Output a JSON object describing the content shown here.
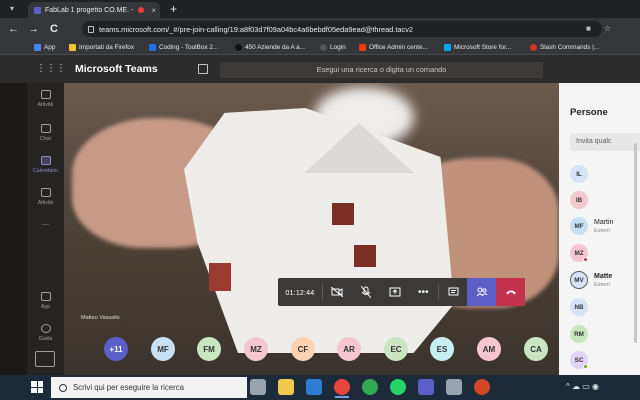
{
  "browser": {
    "tab_title": "FabLab 1 progetto CO.ME. - ",
    "tab_close": "×",
    "new_tab": "+",
    "url": "teams.microsoft.com/_#/pre-join-calling/19:a8f03d7f09a04bc4a6bebdf05eda9ead@thread.tacv2",
    "back": "←",
    "forward": "→",
    "reload": "C",
    "bookmarks": [
      {
        "label": "App",
        "color": "#4285f4"
      },
      {
        "label": "Importati da Firefox",
        "color": "#f4c430"
      },
      {
        "label": "Coding - ToolBox 2...",
        "color": "#1a73e8"
      },
      {
        "label": "450 Aziende da A a...",
        "color": "#111111"
      },
      {
        "label": "Login",
        "color": "#555555"
      },
      {
        "label": "Office Admin cente...",
        "color": "#eb3c00"
      },
      {
        "label": "Microsoft Store for...",
        "color": "#00a4ef"
      },
      {
        "label": "Slash Commands |...",
        "color": "#d93025"
      }
    ]
  },
  "teams": {
    "app_name": "Microsoft Teams",
    "search_placeholder": "Esegui una ricerca o digita un comando",
    "rail": [
      {
        "label": "Attività",
        "active": false
      },
      {
        "label": "Chat",
        "active": false
      },
      {
        "label": "Calendario",
        "active": true
      },
      {
        "label": "Attività",
        "active": false
      },
      {
        "label": "...",
        "active": false
      },
      {
        "label": "App",
        "active": false
      },
      {
        "label": "Guida",
        "active": false
      }
    ],
    "video_name": "Matteo Vassallo",
    "call": {
      "timer": "01:12:44"
    },
    "strip": [
      {
        "initials": "+11",
        "color": "#5b5fc7"
      },
      {
        "initials": "MF",
        "color": "#c7e0f4"
      },
      {
        "initials": "FM",
        "color": "#c9e6c0"
      },
      {
        "initials": "MZ",
        "color": "#f4c6d0"
      },
      {
        "initials": "CF",
        "color": "#fbd3b0"
      },
      {
        "initials": "AR",
        "color": "#f4c6d0"
      },
      {
        "initials": "EC",
        "color": "#c9e6c0"
      },
      {
        "initials": "ES",
        "color": "#c7eef0"
      },
      {
        "initials": "AM",
        "color": "#f4c6d0"
      },
      {
        "initials": "CA",
        "color": "#c9e6c0"
      }
    ],
    "people": {
      "title": "Persone",
      "invite_placeholder": "Invita qualc",
      "list": [
        {
          "initials": "IL",
          "color": "#d6e3f4",
          "name": "",
          "sub": "",
          "dot": ""
        },
        {
          "initials": "IB",
          "color": "#f4c6d0",
          "name": "",
          "sub": "",
          "dot": ""
        },
        {
          "initials": "MF",
          "color": "#c7e0f4",
          "name": "Martin",
          "sub": "Estern",
          "dot": ""
        },
        {
          "initials": "MZ",
          "color": "#f4c6d0",
          "name": "",
          "sub": "",
          "dot": "red"
        },
        {
          "initials": "MV",
          "color": "#d6e3f4",
          "name": "Matte",
          "sub": "Estern",
          "dot": ""
        },
        {
          "initials": "NB",
          "color": "#d6e3f4",
          "name": "",
          "sub": "",
          "dot": ""
        },
        {
          "initials": "RM",
          "color": "#c9e6c0",
          "name": "",
          "sub": "",
          "dot": ""
        },
        {
          "initials": "SC",
          "color": "#e0d3f4",
          "name": "",
          "sub": "",
          "dot": "green"
        }
      ]
    }
  },
  "taskbar": {
    "search_placeholder": "Scrivi qui per eseguire la ricerca",
    "apps": [
      {
        "name": "task-view",
        "color": "#9aa3ad"
      },
      {
        "name": "file-explorer",
        "color": "#f2c94c"
      },
      {
        "name": "mail",
        "color": "#2d7dd2"
      },
      {
        "name": "chrome",
        "color": "#e8453c"
      },
      {
        "name": "chrome-2",
        "color": "#34a853"
      },
      {
        "name": "whatsapp",
        "color": "#25d366"
      },
      {
        "name": "teams",
        "color": "#5b5fc7"
      },
      {
        "name": "shield",
        "color": "#9aa3ad"
      },
      {
        "name": "powerpoint",
        "color": "#d24726"
      }
    ],
    "tray": "^ ☁ ▭ ◉"
  }
}
